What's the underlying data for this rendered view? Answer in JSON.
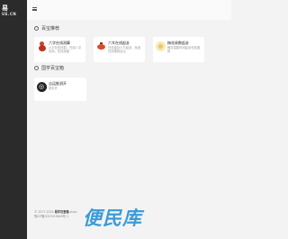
{
  "sidebar": {
    "logo_main": "易",
    "logo_sub": "UE.CN"
  },
  "sections": [
    {
      "title": "百宝推荐",
      "cards": [
        {
          "title": "六字在线测算",
          "desc": "六字在线测算，在线八字查询，在线排盘",
          "icon": "gourd-icon"
        },
        {
          "title": "六爻在线起卦",
          "desc": "在线摇卦六爻起卦，免费在线推算吉凶",
          "icon": "lantern-icon"
        },
        {
          "title": "梅花易数起卦",
          "desc": "梅花易数时间起卦在线推算",
          "icon": "bagua-icon"
        }
      ]
    },
    {
      "title": "国学百宝箱",
      "cards": [
        {
          "title": "吉运推测开",
          "desc": "暂未开",
          "icon": "qr-icon"
        }
      ]
    }
  ],
  "footer": {
    "line1_prefix": "© 2017-2024",
    "line1_brand": "易学百宝箱",
    "line1_suffix": "ztcpt",
    "line2": "豫ICP备2023019649号-1"
  },
  "watermark": "便民库"
}
